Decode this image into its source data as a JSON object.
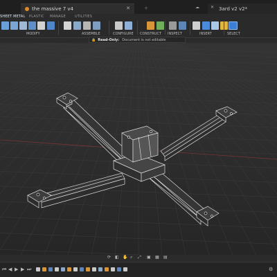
{
  "app": {
    "active_document": "the massive 7 v4",
    "second_document": "3ard v2 v2*"
  },
  "workspace_tabs": [
    "SHEET METAL",
    "PLASTIC",
    "MANAGE",
    "UTILITIES"
  ],
  "toolbar_groups": [
    "MODIFY",
    "ASSEMBLE",
    "CONFIGURE",
    "CONSTRUCT",
    "INSPECT",
    "INSERT",
    "SELECT"
  ],
  "readonly": {
    "title": "Read-Only:",
    "message": "Document is not editable"
  },
  "colors": {
    "accent": "#3a7fd5",
    "background": "#2d2d2d",
    "grid": "#3c3c3c",
    "model_edge": "#d8d8d8",
    "warning": "#d8b74a",
    "axis_red": "#8a3a3a"
  },
  "icons": {
    "lock": "lock-icon",
    "close": "close-icon",
    "fusion_doc": "fusion-document-icon"
  }
}
